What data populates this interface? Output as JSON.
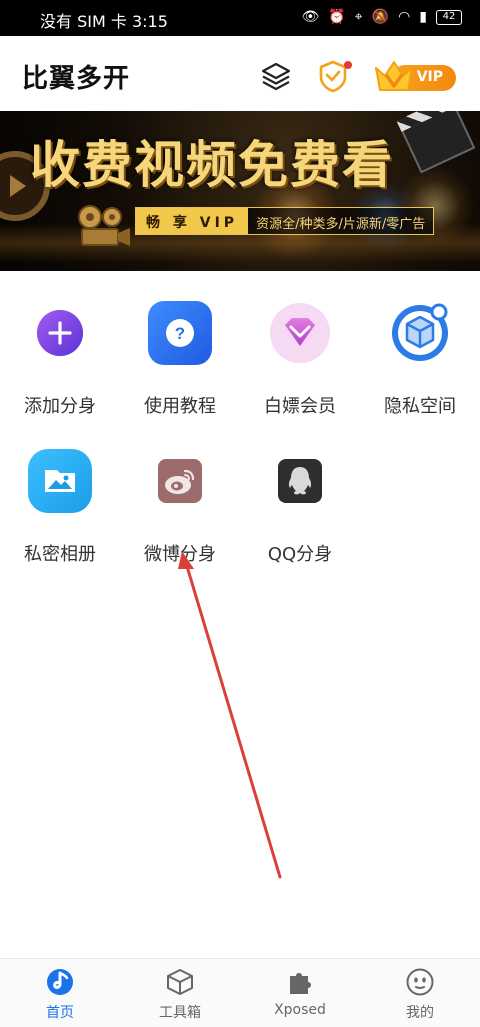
{
  "status_bar": {
    "carrier_time": "没有 SIM 卡 3:15",
    "battery": "42"
  },
  "header": {
    "title": "比翼多开",
    "vip_label": "VIP"
  },
  "banner": {
    "headline": "收费视频免费看",
    "tag": "畅 享 VIP",
    "subline": "资源全/种类多/片源新/零广告"
  },
  "apps": [
    {
      "label": "添加分身",
      "icon": "plus-icon"
    },
    {
      "label": "使用教程",
      "icon": "question-icon"
    },
    {
      "label": "白嫖会员",
      "icon": "diamond-icon"
    },
    {
      "label": "隐私空间",
      "icon": "cube-icon"
    },
    {
      "label": "私密相册",
      "icon": "gallery-icon"
    },
    {
      "label": "微博分身",
      "icon": "weibo-icon"
    },
    {
      "label": "QQ分身",
      "icon": "qq-icon"
    }
  ],
  "bottom_nav": [
    {
      "label": "首页",
      "active": true
    },
    {
      "label": "工具箱",
      "active": false
    },
    {
      "label": "Xposed",
      "active": false
    },
    {
      "label": "我的",
      "active": false
    }
  ],
  "colors": {
    "accent_blue": "#1a73e8",
    "vip_orange": "#f39a14",
    "arrow_red": "#d9403a"
  }
}
